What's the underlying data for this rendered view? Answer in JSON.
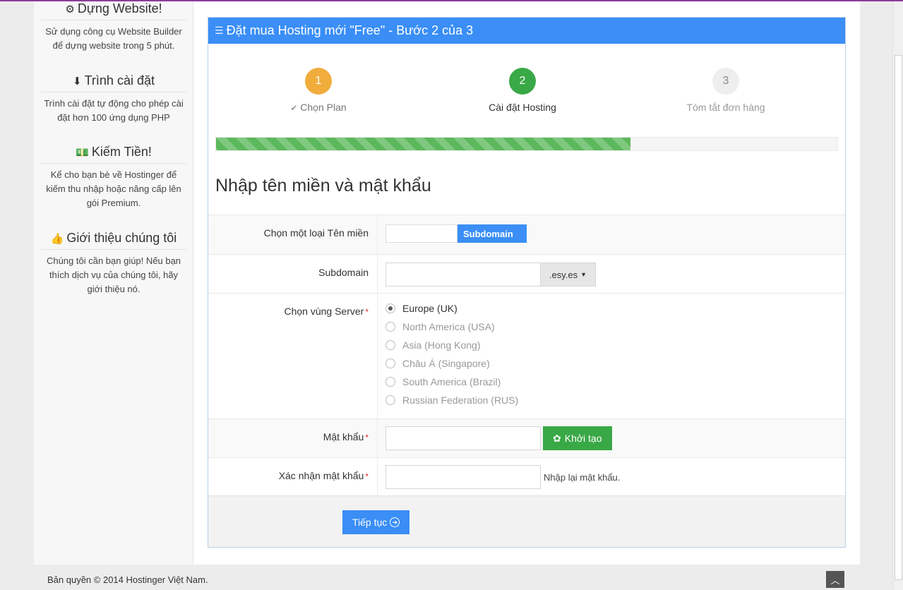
{
  "sidebar": {
    "blocks": [
      {
        "icon": "gears-icon",
        "glyph": "⚙",
        "title": "Dựng Website!",
        "text": "Sử dụng công cụ Website Builder để dựng website trong 5 phút."
      },
      {
        "icon": "download-icon",
        "glyph": "⬇",
        "title": "Trình cài đặt",
        "text": "Trình cài đặt tự động cho phép cài đặt hơn 100 ứng dụng PHP"
      },
      {
        "icon": "money-icon",
        "glyph": "💵",
        "title": "Kiếm Tiền!",
        "text": "Kể cho bạn bè về Hostinger để kiếm thu nhập hoặc nâng cấp lên gói Premium."
      },
      {
        "icon": "thumbs-up-icon",
        "glyph": "👍",
        "title": "Giới thiệu chúng tôi",
        "text": "Chúng tôi cần bạn giúp! Nếu bạn thích dịch vụ của chúng tôi, hãy giới thiệu nó."
      }
    ]
  },
  "panel": {
    "title": "Đặt mua Hosting mới \"Free\" - Bước 2 của 3",
    "steps": [
      {
        "number": "1",
        "label": "Chọn Plan",
        "state": "done",
        "color": "#f0ad3c"
      },
      {
        "number": "2",
        "label": "Cài đặt Hosting",
        "state": "active",
        "color": "#39a846"
      },
      {
        "number": "3",
        "label": "Tóm tắt đơn hàng",
        "state": "pending",
        "color": "#eeeeee"
      }
    ],
    "progress_percent": 66.7,
    "section_title": "Nhập tên miền và mật khẩu"
  },
  "form": {
    "domain_type": {
      "label": "Chọn một loại Tên miền",
      "option_blank": "",
      "option_selected": "Subdomain"
    },
    "subdomain": {
      "label": "Subdomain",
      "value": "",
      "suffix": ".esy.es"
    },
    "server": {
      "label": "Chọn vùng Server",
      "options": [
        {
          "label": "Europe (UK)",
          "selected": true
        },
        {
          "label": "North America (USA)",
          "selected": false
        },
        {
          "label": "Asia (Hong Kong)",
          "selected": false
        },
        {
          "label": "Châu Á (Singapore)",
          "selected": false
        },
        {
          "label": "South America (Brazil)",
          "selected": false
        },
        {
          "label": "Russian Federation (RUS)",
          "selected": false
        }
      ]
    },
    "password": {
      "label": "Mật khẩu",
      "value": "",
      "generate_label": "Khởi tạo"
    },
    "confirm": {
      "label": "Xác nhận mật khẩu",
      "value": "",
      "hint": "Nhập lại mật khẩu."
    },
    "required_mark": "*",
    "submit_label": "Tiếp tục"
  },
  "footer": {
    "copyright": "Bản quyền © 2014 Hostinger Việt Nam."
  },
  "colors": {
    "accent": "#3a8ef6",
    "success": "#39a846",
    "warning": "#f0ad3c",
    "top_border": "#8e3b9e"
  }
}
